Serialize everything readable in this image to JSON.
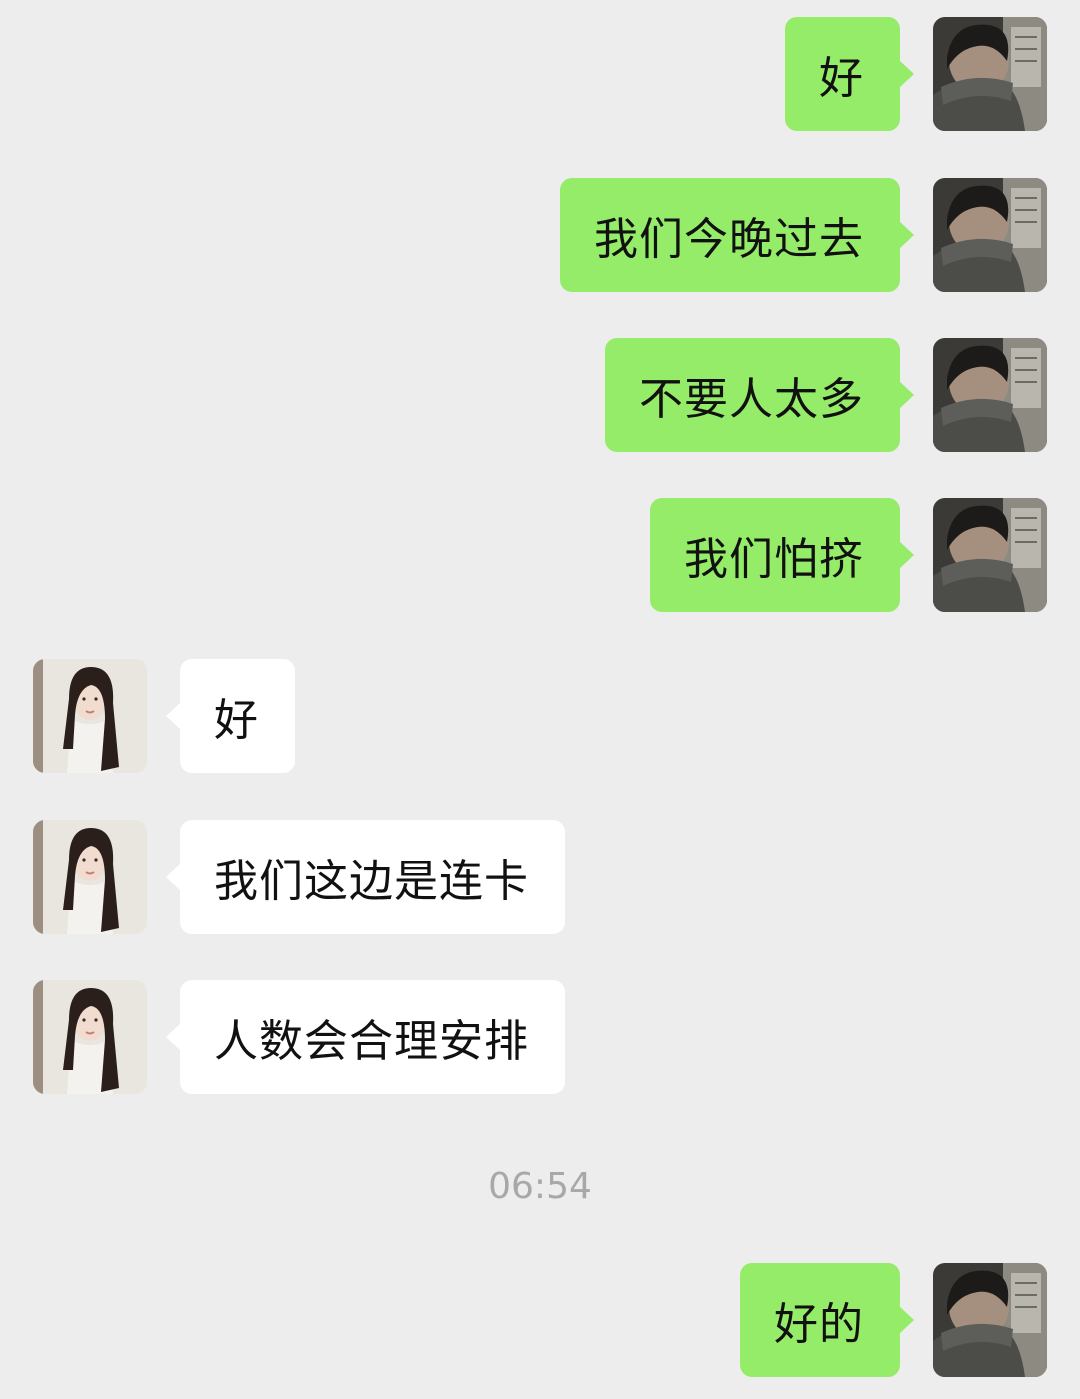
{
  "conversation": {
    "messages": [
      {
        "sender": "me",
        "text": "好"
      },
      {
        "sender": "me",
        "text": "我们今晚过去"
      },
      {
        "sender": "me",
        "text": "不要人太多"
      },
      {
        "sender": "me",
        "text": "我们怕挤"
      },
      {
        "sender": "them",
        "text": "好"
      },
      {
        "sender": "them",
        "text": "我们这边是连卡"
      },
      {
        "sender": "them",
        "text": "人数会合理安排"
      },
      {
        "sender": "me",
        "text": "好的"
      }
    ],
    "timestamp": "06:54"
  },
  "colors": {
    "background": "#ededed",
    "outgoing_bubble": "#95ec69",
    "incoming_bubble": "#ffffff",
    "timestamp_text": "#a8a8a8"
  }
}
